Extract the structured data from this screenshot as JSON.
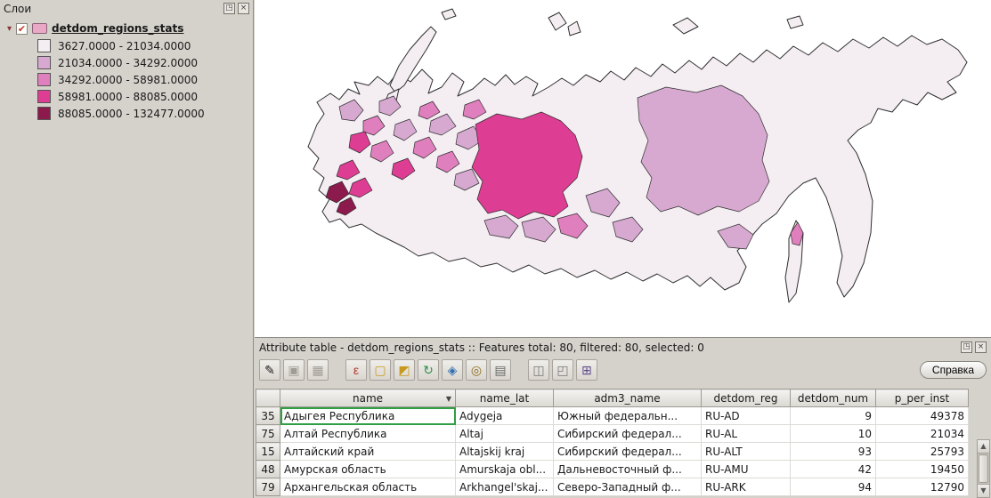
{
  "window_controls": {
    "float_glyph": "◳",
    "close_glyph": "×"
  },
  "layers_panel": {
    "title": "Слои",
    "expander_glyph": "▾",
    "check_glyph": "✔",
    "layer": {
      "name": "detdom_regions_stats",
      "checked": true
    },
    "legend_classes": [
      {
        "label": "3627.0000 - 21034.0000",
        "color": "#f4eef3"
      },
      {
        "label": "21034.0000 - 34292.0000",
        "color": "#d7a9d0"
      },
      {
        "label": "34292.0000 - 58981.0000",
        "color": "#e07fbd"
      },
      {
        "label": "58981.0000 - 88085.0000",
        "color": "#dd3d92"
      },
      {
        "label": "88085.0000 - 132477.0000",
        "color": "#8c1a4c"
      }
    ]
  },
  "attribute_table": {
    "title": "Attribute table - detdom_regions_stats :: Features total: 80, filtered: 80, selected: 0",
    "help_button": "Справка",
    "toolbar": [
      {
        "name": "toggle-editing-button",
        "glyph": "✎",
        "color": "#1a1a1a",
        "disabled": false,
        "gap_after": false
      },
      {
        "name": "save-edits-button",
        "glyph": "▣",
        "color": "#a09c95",
        "disabled": true,
        "gap_after": false
      },
      {
        "name": "delete-selected-button",
        "glyph": "▦",
        "color": "#a09c95",
        "disabled": true,
        "gap_after": true
      },
      {
        "name": "select-by-expression-button",
        "glyph": "ε",
        "color": "#b3332a",
        "disabled": false,
        "gap_after": false
      },
      {
        "name": "unselect-all-button",
        "glyph": "▢",
        "color": "#c79a1e",
        "disabled": false,
        "gap_after": false
      },
      {
        "name": "invert-selection-button",
        "glyph": "◩",
        "color": "#c79a1e",
        "disabled": false,
        "gap_after": false
      },
      {
        "name": "pan-to-selected-button",
        "glyph": "↻",
        "color": "#2f8f4e",
        "disabled": false,
        "gap_after": false
      },
      {
        "name": "zoom-to-selected-button",
        "glyph": "◈",
        "color": "#3470b0",
        "disabled": false,
        "gap_after": false
      },
      {
        "name": "select-features-button",
        "glyph": "◎",
        "color": "#8a6d1f",
        "disabled": false,
        "gap_after": false
      },
      {
        "name": "open-form-button",
        "glyph": "▤",
        "color": "#666666",
        "disabled": false,
        "gap_after": true
      },
      {
        "name": "copy-selected-rows-button",
        "glyph": "◫",
        "color": "#777777",
        "disabled": false,
        "gap_after": false
      },
      {
        "name": "paste-rows-button",
        "glyph": "◰",
        "color": "#777777",
        "disabled": false,
        "gap_after": false
      },
      {
        "name": "field-calculator-button",
        "glyph": "⊞",
        "color": "#5f4b8b",
        "disabled": false,
        "gap_after": false
      }
    ],
    "columns": [
      {
        "key": "name",
        "label": "name",
        "sort": true,
        "align": "left"
      },
      {
        "key": "name_lat",
        "label": "name_lat",
        "sort": false,
        "align": "left"
      },
      {
        "key": "adm3_name",
        "label": "adm3_name",
        "sort": false,
        "align": "left"
      },
      {
        "key": "detdom_reg",
        "label": "detdom_reg",
        "sort": false,
        "align": "left"
      },
      {
        "key": "detdom_num",
        "label": "detdom_num",
        "sort": false,
        "align": "right"
      },
      {
        "key": "p_per_inst",
        "label": "p_per_inst",
        "sort": false,
        "align": "right"
      }
    ],
    "rows": [
      {
        "id": "35",
        "name": "Адыгея Республика",
        "name_lat": "Adygeja",
        "adm3_name": "Южный федеральн...",
        "detdom_reg": "RU-AD",
        "detdom_num": "9",
        "p_per_inst": "49378",
        "current": true
      },
      {
        "id": "75",
        "name": "Алтай Республика",
        "name_lat": "Altaj",
        "adm3_name": "Сибирский федерал...",
        "detdom_reg": "RU-AL",
        "detdom_num": "10",
        "p_per_inst": "21034",
        "current": false
      },
      {
        "id": "15",
        "name": "Алтайский край",
        "name_lat": "Altajskij kraj",
        "adm3_name": "Сибирский федерал...",
        "detdom_reg": "RU-ALT",
        "detdom_num": "93",
        "p_per_inst": "25793",
        "current": false
      },
      {
        "id": "48",
        "name": "Амурская область",
        "name_lat": "Amurskaja obl...",
        "adm3_name": "Дальневосточный ф...",
        "detdom_reg": "RU-AMU",
        "detdom_num": "42",
        "p_per_inst": "19450",
        "current": false
      },
      {
        "id": "79",
        "name": "Архангельская область",
        "name_lat": "Arkhangel'skaj...",
        "adm3_name": "Северо-Западный ф...",
        "detdom_reg": "RU-ARK",
        "detdom_num": "94",
        "p_per_inst": "12790",
        "current": false
      }
    ]
  }
}
